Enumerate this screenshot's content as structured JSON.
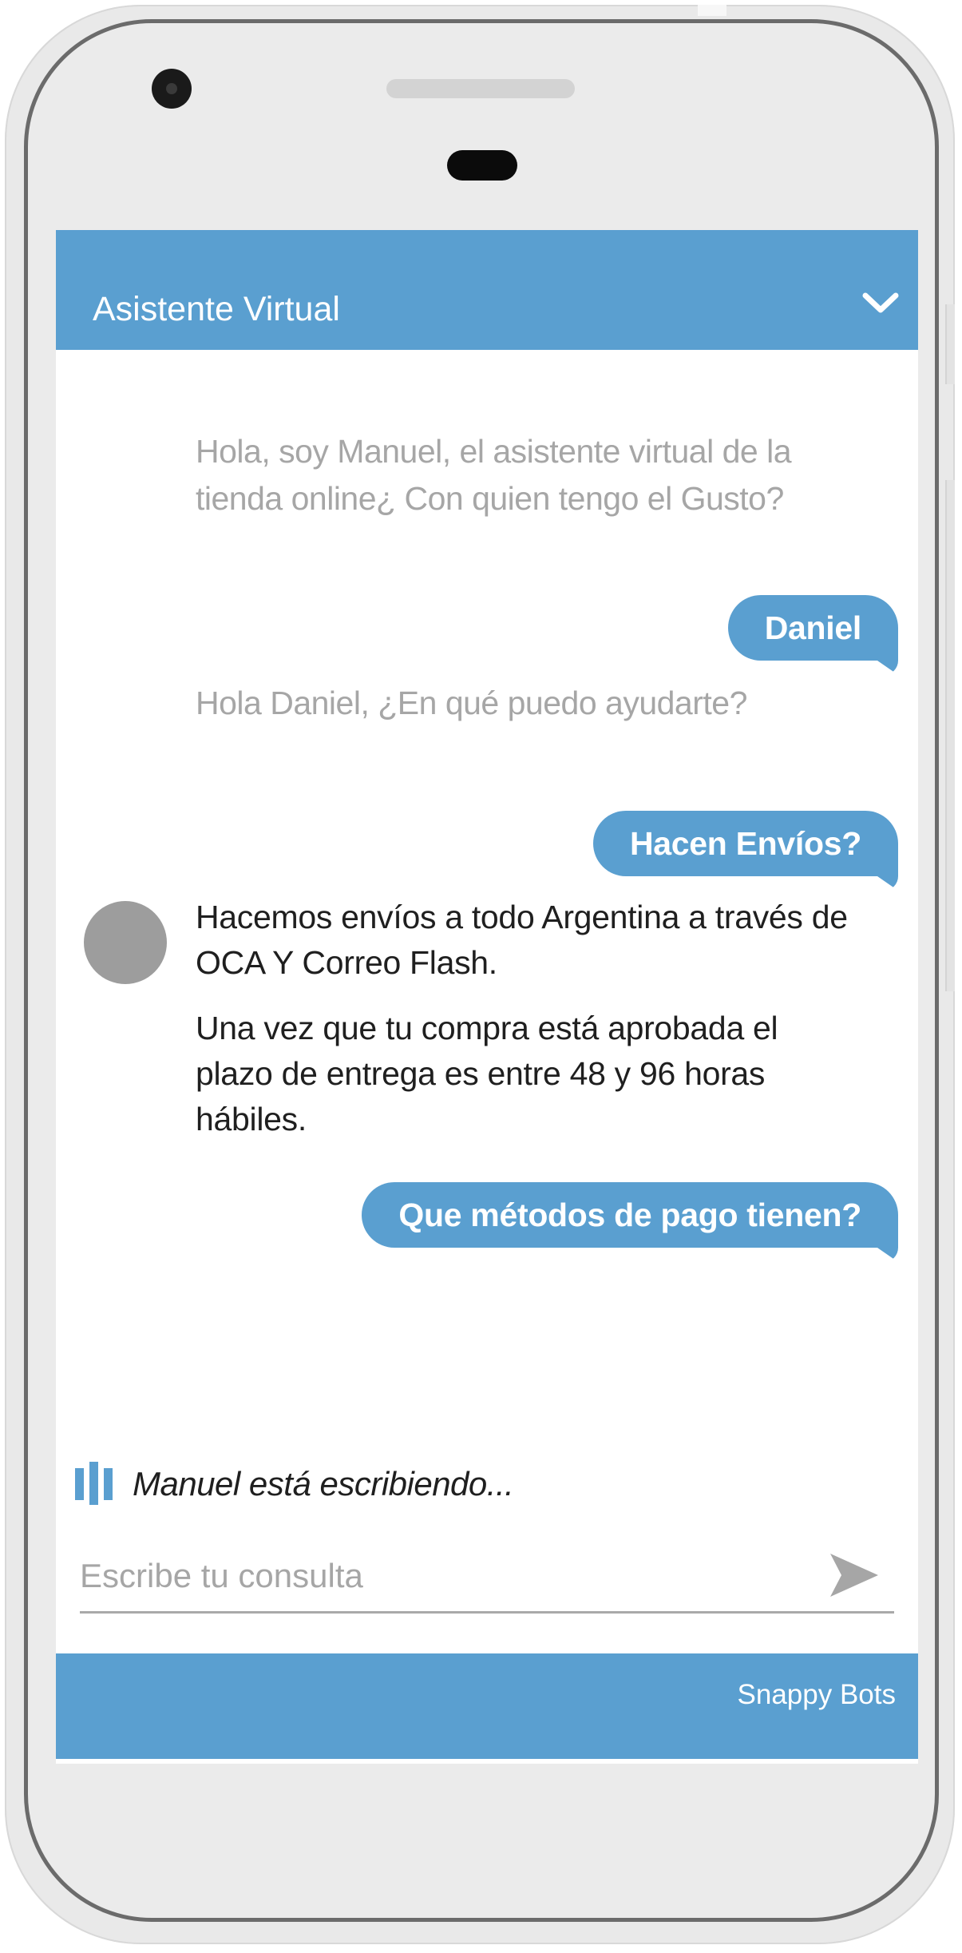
{
  "header": {
    "title": "Asistente Virtual",
    "collapse_icon": "chevron-down-icon"
  },
  "messages": {
    "bot_greeting": "Hola, soy Manuel, el asistente virtual de la tienda online¿ Con quien tengo el Gusto?",
    "user_name": "Daniel",
    "bot_help": "Hola Daniel, ¿En qué puedo ayudarte?",
    "user_question_shipping": "Hacen Envíos?",
    "bot_shipping_1": "Hacemos envíos a todo Argentina a través de OCA Y Correo Flash.",
    "bot_shipping_2": "Una vez que tu compra está aprobada el plazo de entrega es entre 48 y 96 horas hábiles.",
    "user_question_payment": "Que métodos de pago tienen?"
  },
  "typing": {
    "text": "Manuel está escribiendo...",
    "icon": "typing-indicator-icon"
  },
  "input": {
    "placeholder": "Escribe tu consulta",
    "value": "",
    "send_icon": "send-icon"
  },
  "footer": {
    "brand": "Snappy Bots"
  },
  "colors": {
    "accent": "#5a9fd0",
    "muted_text": "#a6a6a6",
    "body_text": "#1f1f1f",
    "avatar": "#9d9d9d",
    "phone_frame": "#e9e9e9",
    "phone_border": "#6b6b6b"
  }
}
